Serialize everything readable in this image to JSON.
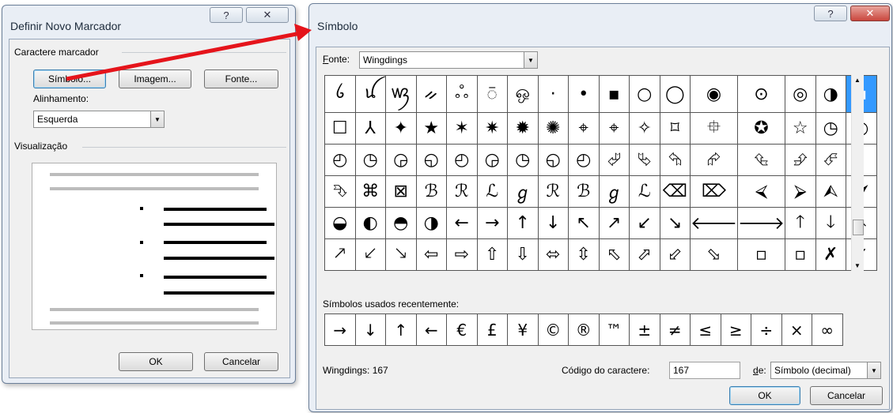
{
  "left_dialog": {
    "title": "Definir Novo Marcador",
    "help_icon": "?",
    "close_icon": "✕",
    "group_caractere": "Caractere marcador",
    "btn_simbolo": "Símbolo...",
    "btn_imagem": "Imagem...",
    "btn_fonte": "Fonte...",
    "alinhamento_label": "Alinhamento:",
    "alinhamento_value": "Esquerda",
    "visualizacao_label": "Visualização",
    "ok": "OK",
    "cancel": "Cancelar"
  },
  "right_dialog": {
    "title": "Símbolo",
    "font_label": "Fonte:",
    "font_value": "Wingdings",
    "recent_label": "Símbolos usados recentemente:",
    "status_text": "Wingdings: 167",
    "code_label": "Código do caractere:",
    "code_value": "167",
    "from_label": "de:",
    "from_value": "Símbolo (decimal)",
    "ok": "OK",
    "cancel": "Cancelar"
  },
  "symbols": [
    [
      "ꪉ",
      "ꪊ",
      "ꪃ",
      "ᨀ",
      "ஃ",
      "ꩼ",
      "ஒ",
      "·",
      "•",
      "▪",
      "○",
      "◯",
      "◉",
      "⊙",
      "◎",
      "◑",
      "▪"
    ],
    [
      "☐",
      "⅄",
      "✦",
      "★",
      "✶",
      "✷",
      "✹",
      "✺",
      "⌖",
      "⌖",
      "✧",
      "⌑",
      "⯐",
      "✪",
      "☆",
      "◷",
      "◵"
    ],
    [
      "◴",
      "◷",
      "◶",
      "◵",
      "◴",
      "◶",
      "◷",
      "◵",
      "◴",
      "⮰",
      "⮱",
      "⮲",
      "⮳",
      "⮴",
      "⮵",
      "⮶"
    ],
    [
      "⮷",
      "⌘",
      "⊠",
      "ℬ",
      "ℛ",
      "ℒ",
      "ℊ",
      "ℛ",
      "ℬ",
      "ℊ",
      "ℒ",
      "⌫",
      "⌦",
      "⮘",
      "⮚",
      "⮙",
      "⮛"
    ],
    [
      "◒",
      "◐",
      "◓",
      "◑",
      "←",
      "→",
      "↑",
      "↓",
      "↖",
      "↗",
      "↙",
      "↘",
      "🡐",
      "🡒",
      "🡑",
      "🡓",
      "🡔"
    ],
    [
      "🡕",
      "🡗",
      "🡖",
      "⇦",
      "⇨",
      "⇧",
      "⇩",
      "⬄",
      "⇳",
      "⬁",
      "⬀",
      "⬃",
      "⬂",
      "▫",
      "▫",
      "✗",
      "✓"
    ]
  ],
  "selected_symbol": {
    "row": 0,
    "col": 16
  },
  "recent_symbols": [
    "→",
    "↓",
    "↑",
    "←",
    "€",
    "£",
    "¥",
    "©",
    "®",
    "™",
    "±",
    "≠",
    "≤",
    "≥",
    "÷",
    "×",
    "∞"
  ],
  "colors": {
    "selection": "#3399ff",
    "arrow": "#e5141b",
    "close_red": "#c9463d"
  }
}
